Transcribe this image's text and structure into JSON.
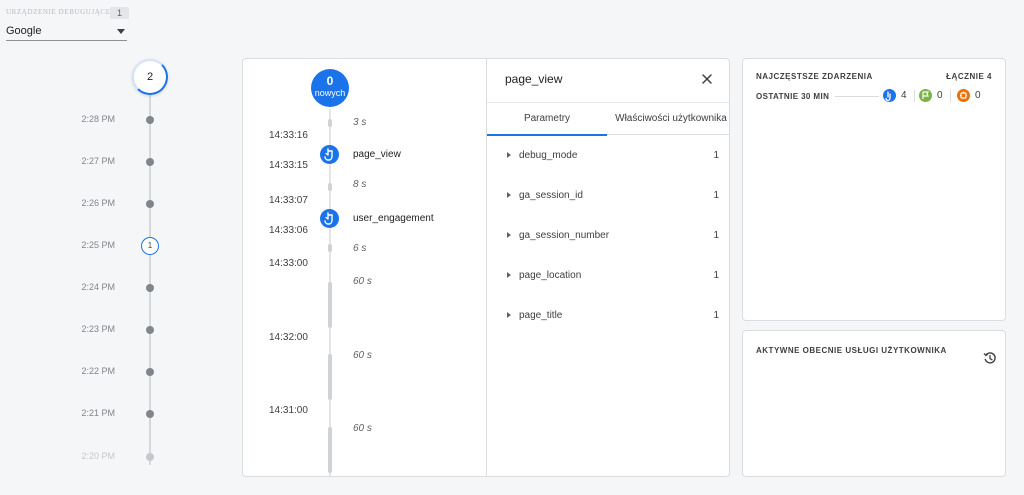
{
  "device": {
    "label": "URZĄDZENIE DEBUGUJĄCE",
    "count": "1",
    "selected": "Google"
  },
  "minute_timeline": {
    "top_count": "2",
    "rows": [
      {
        "time": "2:28 PM",
        "count": null
      },
      {
        "time": "2:27 PM",
        "count": null
      },
      {
        "time": "2:26 PM",
        "count": null
      },
      {
        "time": "2:25 PM",
        "count": "1"
      },
      {
        "time": "2:24 PM",
        "count": null
      },
      {
        "time": "2:23 PM",
        "count": null
      },
      {
        "time": "2:22 PM",
        "count": null
      },
      {
        "time": "2:21 PM",
        "count": null
      },
      {
        "time": "2:20 PM",
        "count": null
      }
    ]
  },
  "seconds_stream": {
    "new_count": "0",
    "new_label": "nowych",
    "timestamps": [
      "14:33:16",
      "14:33:15",
      "14:33:07",
      "14:33:06",
      "14:33:00",
      "14:32:00",
      "14:31:00"
    ],
    "gaps": [
      "3 s",
      "8 s",
      "6 s",
      "60 s",
      "60 s",
      "60 s"
    ],
    "events": [
      "page_view",
      "user_engagement"
    ]
  },
  "event_detail": {
    "title": "page_view",
    "tabs": [
      "Parametry",
      "Właściwości użytkownika"
    ],
    "params": [
      {
        "name": "debug_mode",
        "value": "1"
      },
      {
        "name": "ga_session_id",
        "value": "1"
      },
      {
        "name": "ga_session_number",
        "value": "1"
      },
      {
        "name": "page_location",
        "value": "1"
      },
      {
        "name": "page_title",
        "value": "1"
      }
    ]
  },
  "top_events": {
    "heading": "NAJCZĘSTSZE ZDARZENIA",
    "total": "ŁĄCZNIE 4",
    "period": "OSTATNIE 30 MIN",
    "stats": [
      {
        "icon": "event-icon",
        "color": "#1a73e8",
        "value": "4"
      },
      {
        "icon": "conversion-flag-icon",
        "color": "#7cb342",
        "value": "0"
      },
      {
        "icon": "error-icon",
        "color": "#e8710a",
        "value": "0"
      }
    ]
  },
  "active_properties": {
    "heading": "AKTYWNE OBECNIE USŁUGI UŻYTKOWNIKA",
    "icon": "history-icon"
  },
  "colors": {
    "accent": "#1a73e8",
    "background": "#f4f6f8"
  }
}
